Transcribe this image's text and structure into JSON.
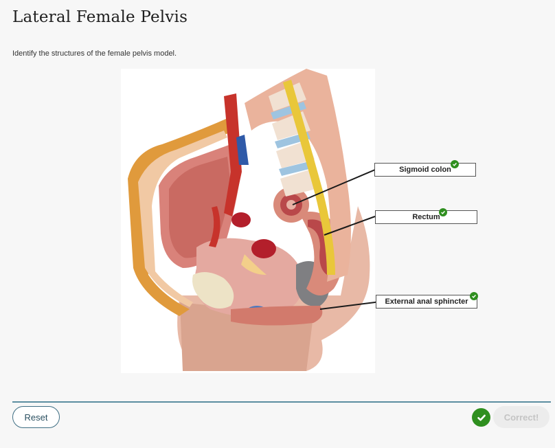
{
  "page": {
    "title": "Lateral Female Pelvis",
    "instructions": "Identify the structures of the female pelvis model."
  },
  "labels": [
    {
      "text": "Sigmoid colon",
      "status": "correct"
    },
    {
      "text": "Rectum",
      "status": "correct"
    },
    {
      "text": "External anal sphincter",
      "status": "correct"
    }
  ],
  "footer": {
    "reset_label": "Reset",
    "result_label": "Correct!"
  },
  "colors": {
    "accent": "#3e6e83",
    "divider": "#5b8ea0",
    "success": "#2f8f1f"
  },
  "icons": {
    "label_status": "check-circle-icon",
    "result_status": "check-circle-icon"
  }
}
